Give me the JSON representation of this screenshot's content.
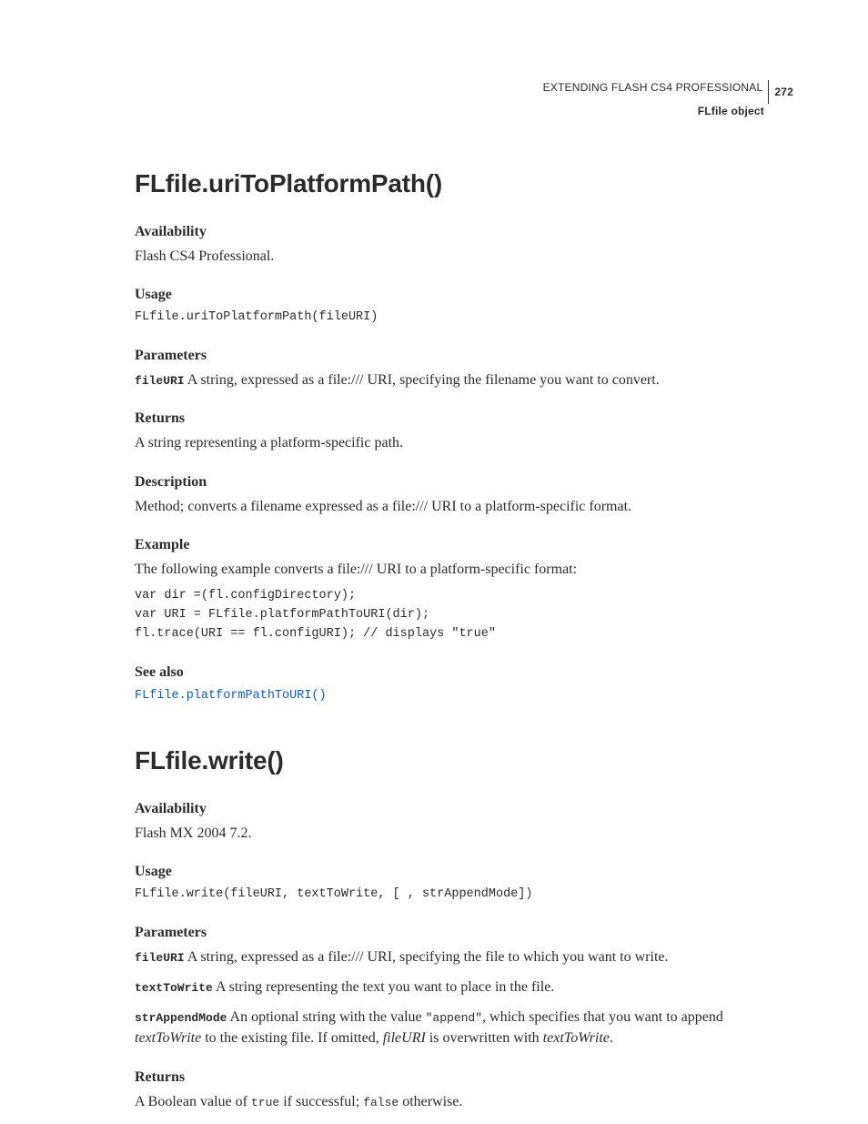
{
  "header": {
    "book_title": "EXTENDING FLASH CS4 PROFESSIONAL",
    "page_num": "272",
    "section": "FLfile object"
  },
  "s1": {
    "title": "FLfile.uriToPlatformPath()",
    "availability_h": "Availability",
    "availability_t": "Flash CS4 Professional.",
    "usage_h": "Usage",
    "usage_code": "FLfile.uriToPlatformPath(fileURI)",
    "params_h": "Parameters",
    "param_name": "fileURI",
    "param_desc": "  A string, expressed as a file:/// URI, specifying the filename you want to convert.",
    "returns_h": "Returns",
    "returns_t": "A string representing a platform-specific path.",
    "desc_h": "Description",
    "desc_t": "Method; converts a filename expressed as a file:/// URI to a platform-specific format.",
    "example_h": "Example",
    "example_intro": "The following example converts a file:/// URI to a platform-specific format:",
    "example_code": "var dir =(fl.configDirectory);\nvar URI = FLfile.platformPathToURI(dir);\nfl.trace(URI == fl.configURI); // displays \"true\"",
    "seealso_h": "See also",
    "seealso_link": "FLfile.platformPathToURI()"
  },
  "s2": {
    "title": "FLfile.write()",
    "availability_h": "Availability",
    "availability_t": "Flash MX 2004 7.2.",
    "usage_h": "Usage",
    "usage_code": "FLfile.write(fileURI, textToWrite, [ , strAppendMode])",
    "params_h": "Parameters",
    "p1_name": "fileURI",
    "p1_desc": "  A string, expressed as a file:/// URI, specifying the file to which you want to write.",
    "p2_name": "textToWrite",
    "p2_desc": "  A string representing the text you want to place in the file.",
    "p3_name": "strAppendMode",
    "p3_pre": "  An optional string with the value ",
    "p3_code": "\"append\"",
    "p3_mid": ", which specifies that you want to append ",
    "p3_em1": "textToWrite",
    "p3_mid2": " to the existing file. If omitted, ",
    "p3_em2": "fileURI",
    "p3_mid3": " is overwritten with ",
    "p3_em3": "textToWrite",
    "p3_end": ".",
    "returns_h": "Returns",
    "ret_pre": "A Boolean value of ",
    "ret_true": "true",
    "ret_mid": " if successful; ",
    "ret_false": "false",
    "ret_end": " otherwise."
  }
}
